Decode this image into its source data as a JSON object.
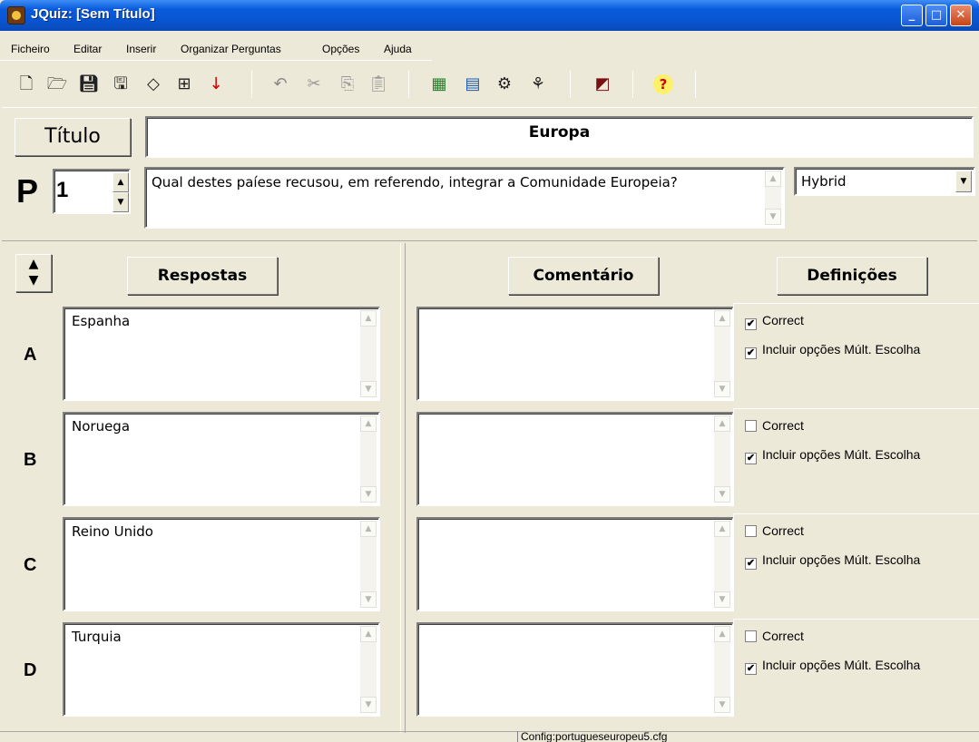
{
  "window": {
    "title": "JQuiz: [Sem Título]"
  },
  "menu": [
    "Ficheiro",
    "Editar",
    "Inserir",
    "Organizar Perguntas",
    "Opções",
    "Ajuda"
  ],
  "toolbar_icons": [
    "new-file-icon",
    "open-folder-icon",
    "save-icon",
    "save-as-icon",
    "eraser-icon",
    "web-export-icon",
    "down-arrow-icon",
    "undo-icon",
    "cut-icon",
    "copy-icon",
    "paste-icon",
    "image-icon",
    "picture-icon",
    "globe-icon",
    "web-icon",
    "export-icon",
    "help-icon"
  ],
  "header": {
    "title_button": "Título",
    "title_value": "Europa",
    "question_label": "P",
    "question_number": "1",
    "question_text": "Qual destes paíese recusou, em referendo, integrar a Comunidade Europeia?",
    "question_type": "Hybrid"
  },
  "columns": {
    "answers": "Respostas",
    "feedback": "Comentário",
    "settings": "Definições"
  },
  "answers": [
    {
      "letter": "A",
      "text": "Espanha",
      "feedback": "",
      "correct": true,
      "include": true
    },
    {
      "letter": "B",
      "text": "Noruega",
      "feedback": "",
      "correct": false,
      "include": true
    },
    {
      "letter": "C",
      "text": "Reino Unido",
      "feedback": "",
      "correct": false,
      "include": true
    },
    {
      "letter": "D",
      "text": "Turquia",
      "feedback": "",
      "correct": false,
      "include": true
    }
  ],
  "labels": {
    "correct": "Correct",
    "include": "Incluir opções Múlt. Escolha"
  },
  "status": {
    "config": "Config:portugueseuropeu5.cfg"
  }
}
